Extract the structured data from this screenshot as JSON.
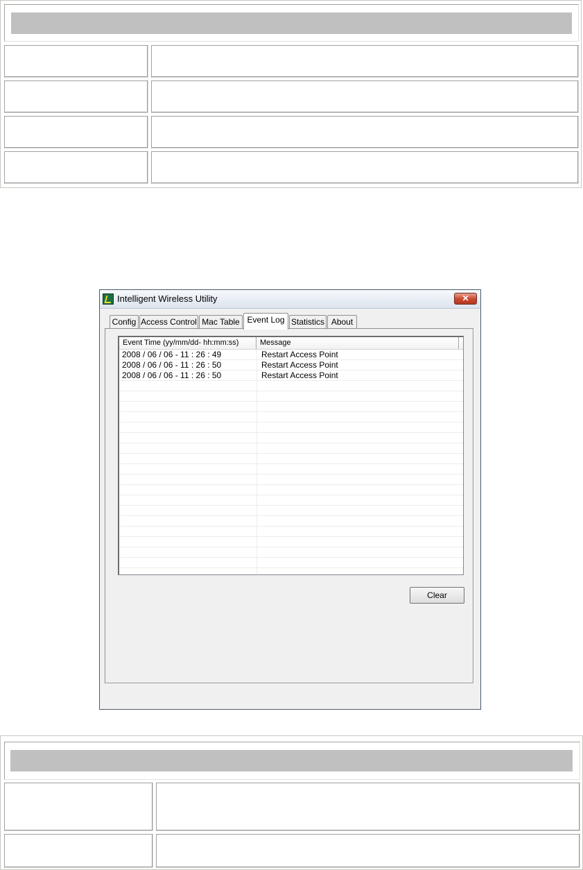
{
  "window": {
    "title": "Intelligent Wireless Utility",
    "close_glyph": "✕",
    "tabs": [
      {
        "label": "Config"
      },
      {
        "label": "Access Control"
      },
      {
        "label": "Mac Table"
      },
      {
        "label": "Event Log",
        "active": true
      },
      {
        "label": "Statistics"
      },
      {
        "label": "About"
      }
    ]
  },
  "event_log": {
    "columns": [
      "Event Time (yy/mm/dd- hh:mm:ss)",
      "Message"
    ],
    "rows": [
      {
        "time": "2008 / 06 / 06 - 11 : 26 : 49",
        "message": "Restart Access Point"
      },
      {
        "time": "2008 / 06 / 06 - 11 : 26 : 50",
        "message": "Restart Access Point"
      },
      {
        "time": "2008 / 06 / 06 - 11 : 26 : 50",
        "message": "Restart Access Point"
      }
    ],
    "clear_label": "Clear"
  },
  "colors": {
    "header_bar": "#c0c0c0",
    "close_button": "#c9452c",
    "dialog_bg": "#f0f0f0"
  }
}
